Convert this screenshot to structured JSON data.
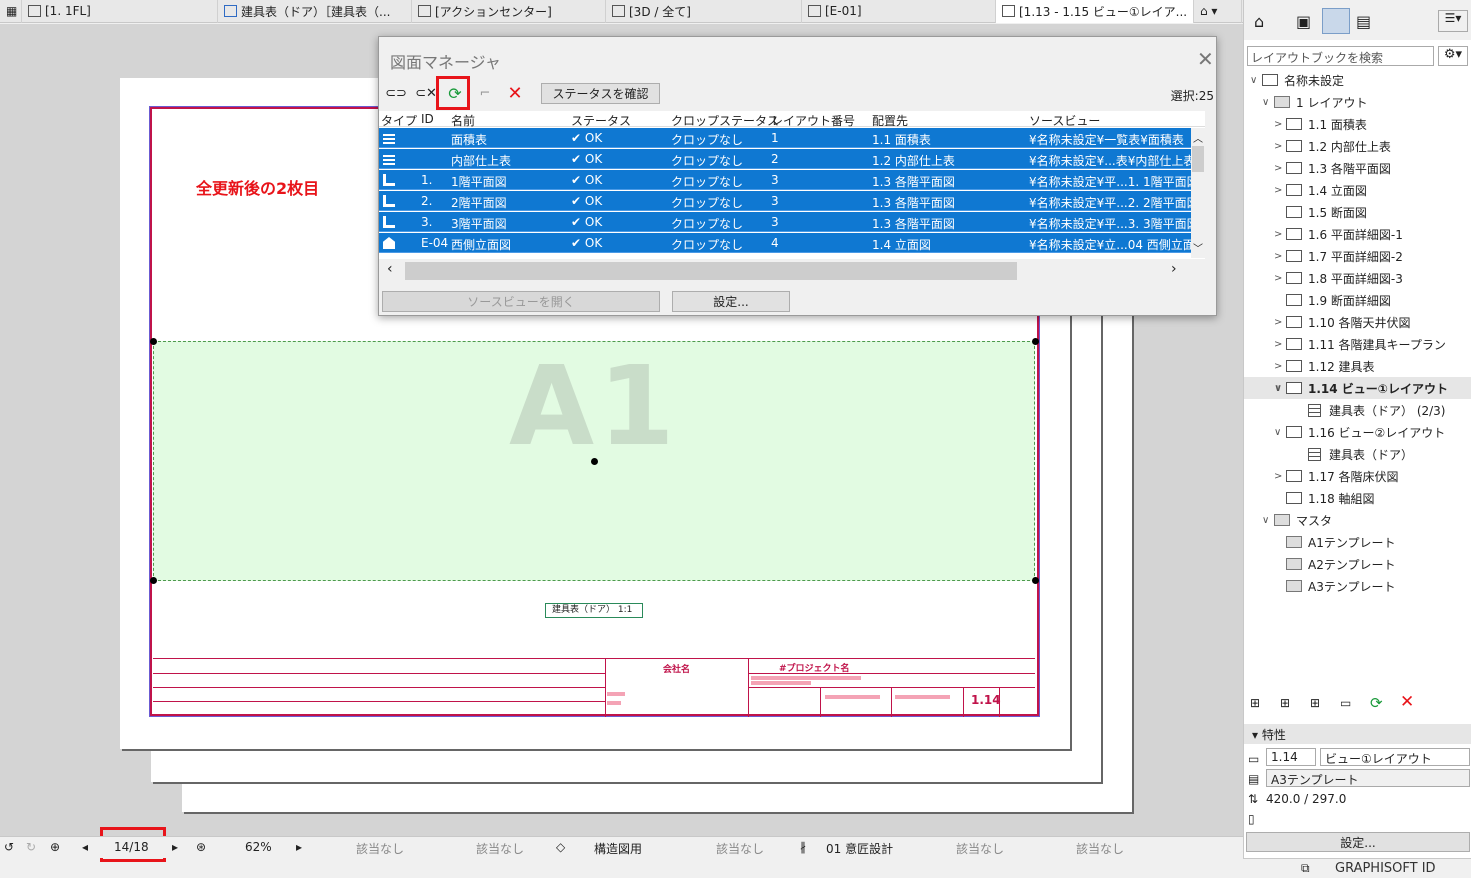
{
  "tabs": [
    {
      "label": "[1. 1FL]"
    },
    {
      "label": "建具表（ドア）［建具表（..."
    },
    {
      "label": "[アクションセンター]"
    },
    {
      "label": "[3D / 全て]"
    },
    {
      "label": "[E-01]"
    },
    {
      "label": "[1.13 - 1.15 ビュー①レイア..."
    }
  ],
  "annotation": "全更新後の2枚目",
  "canvas": {
    "zone_label": "A1",
    "drawing_tag": "建具表（ドア） 1:1",
    "company": "会社名",
    "project": "#プロジェクト名",
    "sheet_no": "1.14"
  },
  "dialog": {
    "title": "図面マネージャ",
    "check_status": "ステータスを確認",
    "selection": "選択:25",
    "columns": [
      "タイプ",
      "ID",
      "名前",
      "ステータス",
      "クロップステータス",
      "レイアウト番号",
      "配置先",
      "ソースビュー"
    ],
    "rows": [
      {
        "type": "grid",
        "id": "",
        "name": "面積表",
        "status": "OK",
        "crop": "クロップなし",
        "layout": "1",
        "place": "1.1 面積表",
        "source": "¥名称未設定¥一覧表¥面積表"
      },
      {
        "type": "grid",
        "id": "",
        "name": "内部仕上表",
        "status": "OK",
        "crop": "クロップなし",
        "layout": "2",
        "place": "1.2 内部仕上表",
        "source": "¥名称未設定¥...表¥内部仕上表"
      },
      {
        "type": "plan",
        "id": "1.",
        "name": "1階平面図",
        "status": "OK",
        "crop": "クロップなし",
        "layout": "3",
        "place": "1.3 各階平面図",
        "source": "¥名称未設定¥平...1. 1階平面図"
      },
      {
        "type": "plan",
        "id": "2.",
        "name": "2階平面図",
        "status": "OK",
        "crop": "クロップなし",
        "layout": "3",
        "place": "1.3 各階平面図",
        "source": "¥名称未設定¥平...2. 2階平面図"
      },
      {
        "type": "plan",
        "id": "3.",
        "name": "3階平面図",
        "status": "OK",
        "crop": "クロップなし",
        "layout": "3",
        "place": "1.3 各階平面図",
        "source": "¥名称未設定¥平...3. 3階平面図"
      },
      {
        "type": "elev",
        "id": "E-04",
        "name": "西側立面図",
        "status": "OK",
        "crop": "クロップなし",
        "layout": "4",
        "place": "1.4 立面図",
        "source": "¥名称未設定¥立...04 西側立面"
      }
    ],
    "open_source": "ソースビューを開く",
    "settings": "設定..."
  },
  "statusbar": {
    "page": "14/18",
    "zoom": "62%",
    "none1": "該当なし",
    "none2": "該当なし",
    "structure": "構造図用",
    "none3": "該当なし",
    "design": "01 意匠設計",
    "none4": "該当なし",
    "none5": "該当なし"
  },
  "panel": {
    "search_placeholder": "レイアウトブックを検索",
    "tree": [
      {
        "label": "名称未設定",
        "level": 0,
        "kind": "book",
        "arrow": "∨"
      },
      {
        "label": "1 レイアウト",
        "level": 1,
        "kind": "folder",
        "arrow": "∨"
      },
      {
        "label": "1.1 面積表",
        "level": 2,
        "kind": "page",
        "arrow": ">"
      },
      {
        "label": "1.2 内部仕上表",
        "level": 2,
        "kind": "page",
        "arrow": ">"
      },
      {
        "label": "1.3 各階平面図",
        "level": 2,
        "kind": "page",
        "arrow": ">"
      },
      {
        "label": "1.4 立面図",
        "level": 2,
        "kind": "page",
        "arrow": ">"
      },
      {
        "label": "1.5 断面図",
        "level": 2,
        "kind": "page",
        "arrow": ""
      },
      {
        "label": "1.6 平面詳細図-1",
        "level": 2,
        "kind": "page",
        "arrow": ">"
      },
      {
        "label": "1.7 平面詳細図-2",
        "level": 2,
        "kind": "page",
        "arrow": ">"
      },
      {
        "label": "1.8 平面詳細図-3",
        "level": 2,
        "kind": "page",
        "arrow": ">"
      },
      {
        "label": "1.9 断面詳細図",
        "level": 2,
        "kind": "page",
        "arrow": ""
      },
      {
        "label": "1.10 各階天井伏図",
        "level": 2,
        "kind": "page",
        "arrow": ">"
      },
      {
        "label": "1.11 各階建具キープラン",
        "level": 2,
        "kind": "page",
        "arrow": ">"
      },
      {
        "label": "1.12 建具表",
        "level": 2,
        "kind": "page",
        "arrow": ">"
      },
      {
        "label": "1.14 ビュー①レイアウト",
        "level": 2,
        "kind": "page",
        "arrow": "∨",
        "selected": true
      },
      {
        "label": "建具表（ドア） (2/3)",
        "level": 3,
        "kind": "grid",
        "arrow": ""
      },
      {
        "label": "1.16 ビュー②レイアウト",
        "level": 2,
        "kind": "page",
        "arrow": "∨"
      },
      {
        "label": "建具表（ドア）",
        "level": 3,
        "kind": "grid",
        "arrow": ""
      },
      {
        "label": "1.17 各階床伏図",
        "level": 2,
        "kind": "page",
        "arrow": ">"
      },
      {
        "label": "1.18 軸組図",
        "level": 2,
        "kind": "page",
        "arrow": ""
      },
      {
        "label": "マスタ",
        "level": 1,
        "kind": "folder",
        "arrow": "∨"
      },
      {
        "label": "A1テンプレート",
        "level": 2,
        "kind": "master",
        "arrow": ""
      },
      {
        "label": "A2テンプレート",
        "level": 2,
        "kind": "master",
        "arrow": ""
      },
      {
        "label": "A3テンプレート",
        "level": 2,
        "kind": "master",
        "arrow": ""
      }
    ],
    "props_title": "特性",
    "prop_id": "1.14",
    "prop_name": "ビュー①レイアウト",
    "prop_master": "A3テンプレート",
    "prop_size": "420.0 / 297.0",
    "settings": "設定...",
    "brand": "GRAPHISOFT ID"
  },
  "colors": {
    "selection": "#0f78d2",
    "highlight": "#e8141a",
    "drawing_red": "#c0134a"
  }
}
